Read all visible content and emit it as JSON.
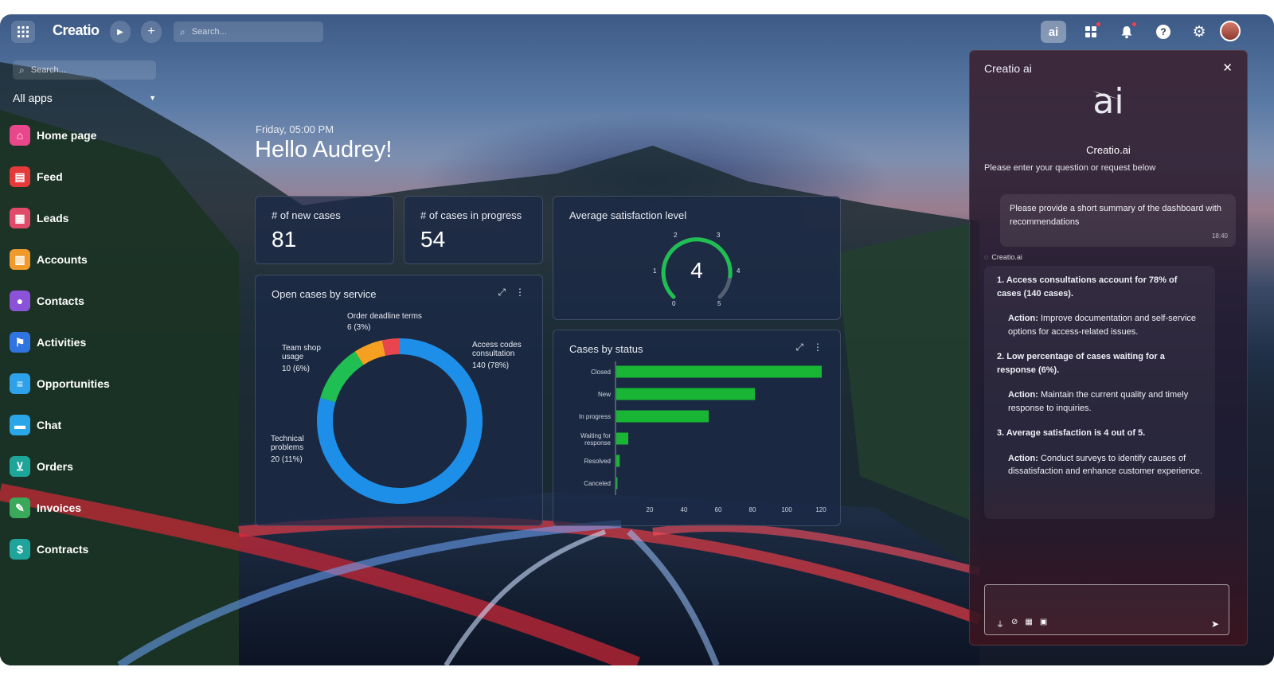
{
  "topbar": {
    "logo": "Creatio",
    "search_placeholder": "Search...",
    "ai_button": "ai"
  },
  "sidebar": {
    "search_placeholder": "Search...",
    "all_apps": "All apps",
    "items": [
      {
        "label": "Home page",
        "icon": "home-icon",
        "color": "#e8478b"
      },
      {
        "label": "Feed",
        "icon": "feed-icon",
        "color": "#e53a3a"
      },
      {
        "label": "Leads",
        "icon": "leads-icon",
        "color": "#e24a6a"
      },
      {
        "label": "Accounts",
        "icon": "accounts-icon",
        "color": "#f09a2c"
      },
      {
        "label": "Contacts",
        "icon": "contacts-icon",
        "color": "#8a53d8"
      },
      {
        "label": "Activities",
        "icon": "activities-icon",
        "color": "#2f74e0"
      },
      {
        "label": "Opportunities",
        "icon": "opportunities-icon",
        "color": "#2fa1ea"
      },
      {
        "label": "Chat",
        "icon": "chat-icon",
        "color": "#2aa6e8"
      },
      {
        "label": "Orders",
        "icon": "orders-icon",
        "color": "#1ea59a"
      },
      {
        "label": "Invoices",
        "icon": "invoices-icon",
        "color": "#3aaa5a"
      },
      {
        "label": "Contracts",
        "icon": "contracts-icon",
        "color": "#1fa39a"
      }
    ]
  },
  "greeting": {
    "datetime": "Friday, 05:00 PM",
    "hello": "Hello Audrey!"
  },
  "kpis": [
    {
      "title": "# of new cases",
      "value": "81"
    },
    {
      "title": "# of cases in progress",
      "value": "54"
    }
  ],
  "satisfaction": {
    "title": "Average satisfaction level",
    "value": "4",
    "ticks": [
      "0",
      "1",
      "2",
      "3",
      "4",
      "5"
    ]
  },
  "open_cases": {
    "title": "Open cases by service",
    "labels": [
      {
        "name": "Order deadline terms",
        "value": "6 (3%)"
      },
      {
        "name": "Access codes consultation",
        "value": "140 (78%)"
      },
      {
        "name": "Team shop usage",
        "value": "10 (6%)"
      },
      {
        "name": "Technical problems",
        "value": "20 (11%)"
      }
    ]
  },
  "cases_status": {
    "title": "Cases by status"
  },
  "chart_data": [
    {
      "type": "pie",
      "title": "Open cases by service",
      "categories": [
        "Access codes consultation",
        "Technical problems",
        "Team shop usage",
        "Order deadline terms"
      ],
      "values": [
        140,
        20,
        10,
        6
      ],
      "percent": [
        78,
        11,
        6,
        3
      ],
      "colors": [
        "#1e8fe8",
        "#1fbf53",
        "#f5a020",
        "#e8464e"
      ]
    },
    {
      "type": "bar",
      "title": "Cases by status",
      "categories": [
        "Closed",
        "New",
        "In progress",
        "Waiting for response",
        "Resolved",
        "Canceled"
      ],
      "values": [
        120,
        81,
        54,
        7,
        2,
        0
      ],
      "xticks": [
        "20",
        "40",
        "60",
        "80",
        "100",
        "120"
      ],
      "xlim": [
        0,
        120
      ],
      "color": "#19b534"
    }
  ],
  "ai": {
    "header": "Creatio ai",
    "logo": "ai",
    "name": "Creatio.ai",
    "subtitle": "Please enter your question or request below",
    "user_message": "Please provide a short summary of the dashboard with recommendations",
    "user_time": "18:40",
    "from_label": "Creatio.ai",
    "answer": [
      {
        "point": "1. Access consultations account for 78% of cases (140 cases).",
        "action_label": "Action:",
        "action": "Improve documentation and self-service options for access-related issues."
      },
      {
        "point": "2. Low percentage of cases waiting for a response (6%).",
        "action_label": "Action:",
        "action": "Maintain the current quality and timely response to inquiries."
      },
      {
        "point": "3. Average satisfaction is 4 out of 5.",
        "action_label": "Action:",
        "action": "Conduct surveys to identify causes of dissatisfaction and enhance customer experience."
      }
    ]
  }
}
